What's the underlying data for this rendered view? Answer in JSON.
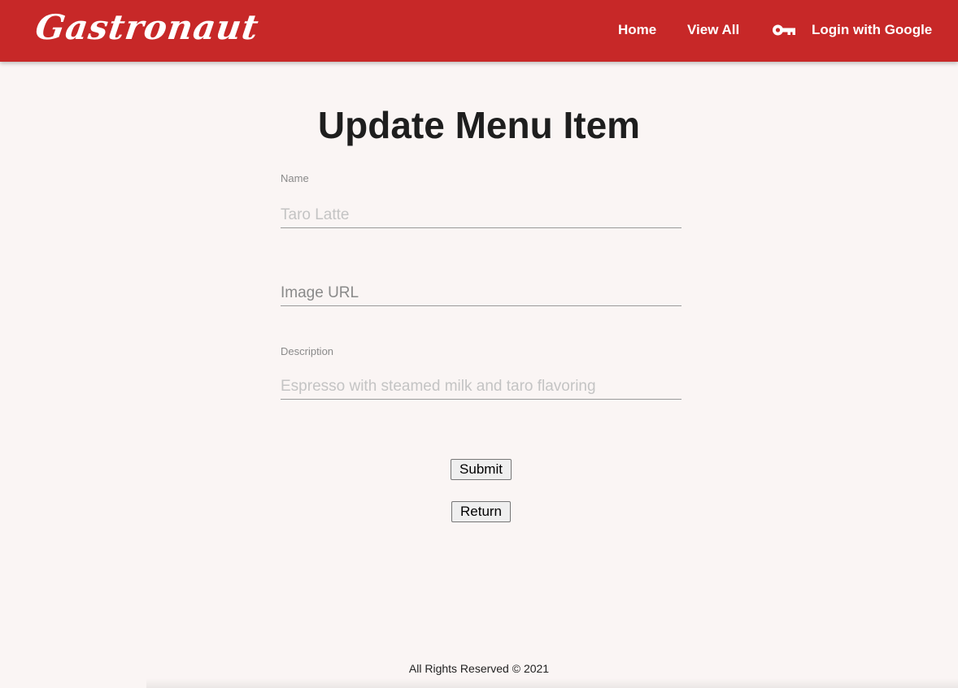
{
  "navbar": {
    "brand": "Gastronaut",
    "links": [
      {
        "label": "Home"
      },
      {
        "label": "View All"
      },
      {
        "label": "Login with Google",
        "icon": "key-icon"
      }
    ],
    "color": "#c72828"
  },
  "page": {
    "title": "Update Menu Item"
  },
  "form": {
    "name": {
      "label": "Name",
      "value": "",
      "placeholder": "Taro Latte"
    },
    "image_url": {
      "value": "",
      "placeholder": "Image URL"
    },
    "description": {
      "label": "Description",
      "value": "",
      "placeholder": "Espresso with steamed milk and taro flavoring"
    },
    "submit_label": "Submit",
    "return_label": "Return"
  },
  "footer": {
    "text": "All Rights Reserved © 2021"
  }
}
